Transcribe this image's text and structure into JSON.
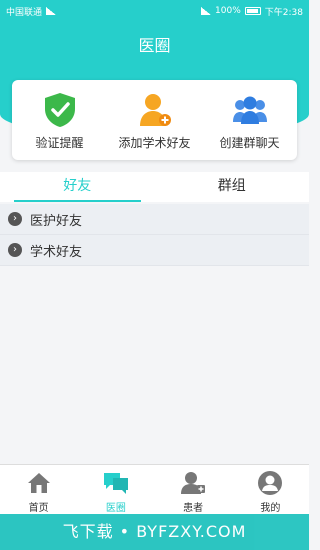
{
  "status": {
    "carrier": "中国联通",
    "battery": "100%",
    "time": "下午2:38"
  },
  "header": {
    "title": "医圈"
  },
  "actions": [
    {
      "label": "验证提醒",
      "icon": "shield-check-icon"
    },
    {
      "label": "添加学术好友",
      "icon": "add-user-icon"
    },
    {
      "label": "创建群聊天",
      "icon": "group-icon"
    }
  ],
  "tabs": [
    {
      "label": "好友",
      "active": true
    },
    {
      "label": "群组",
      "active": false
    }
  ],
  "list": [
    {
      "label": "医护好友"
    },
    {
      "label": "学术好友"
    }
  ],
  "bottom_nav": [
    {
      "label": "首页",
      "icon": "home-icon"
    },
    {
      "label": "医圈",
      "icon": "chat-icon"
    },
    {
      "label": "患者",
      "icon": "patient-icon"
    },
    {
      "label": "我的",
      "icon": "profile-icon"
    }
  ],
  "watermark": "飞下载 • BYFZXY.COM",
  "colors": {
    "accent": "#26cfcb"
  }
}
